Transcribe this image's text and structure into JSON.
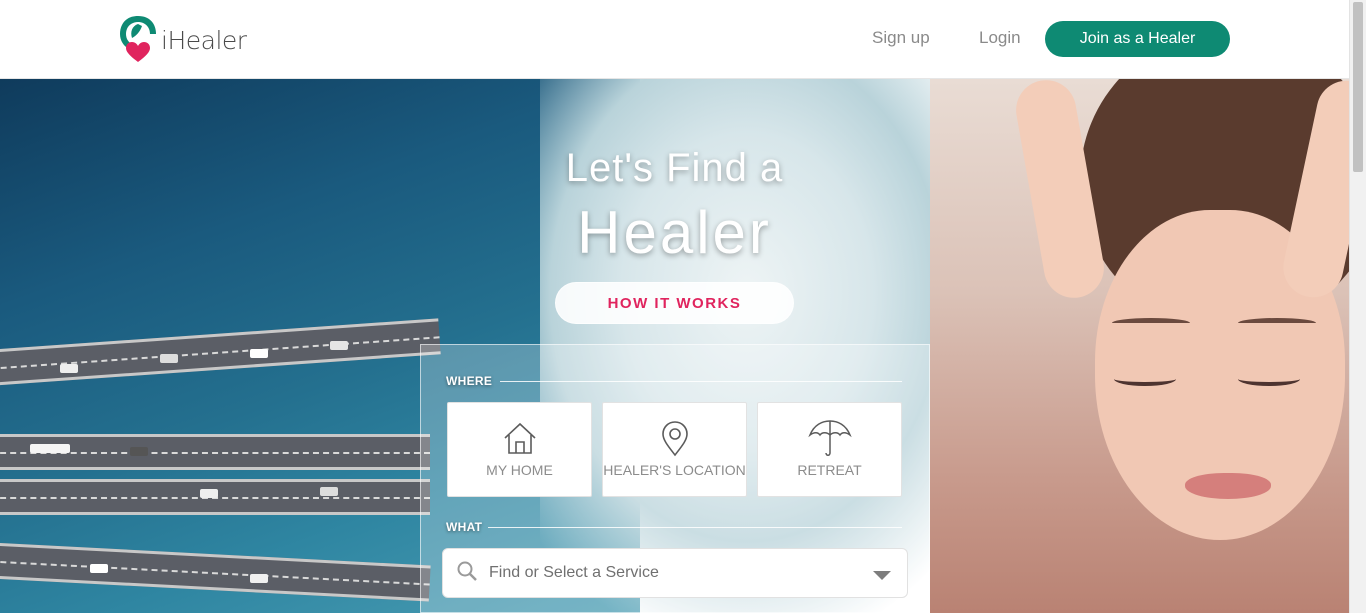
{
  "brand": {
    "name": "iHealer",
    "accent": "#0e8a73",
    "heart": "#e0245e"
  },
  "nav": {
    "signup": "Sign up",
    "login": "Login",
    "join": "Join as a Healer"
  },
  "hero": {
    "headline_line1": "Let's Find a",
    "headline_line2": "Healer",
    "how_it_works": "HOW IT WORKS"
  },
  "search": {
    "where_label": "WHERE",
    "options": [
      {
        "label": "MY HOME",
        "icon": "home-icon"
      },
      {
        "label": "HEALER'S LOCATION",
        "icon": "location-pin-icon"
      },
      {
        "label": "RETREAT",
        "icon": "umbrella-icon"
      }
    ],
    "what_label": "WHAT",
    "service_placeholder": "Find or Select a Service"
  }
}
